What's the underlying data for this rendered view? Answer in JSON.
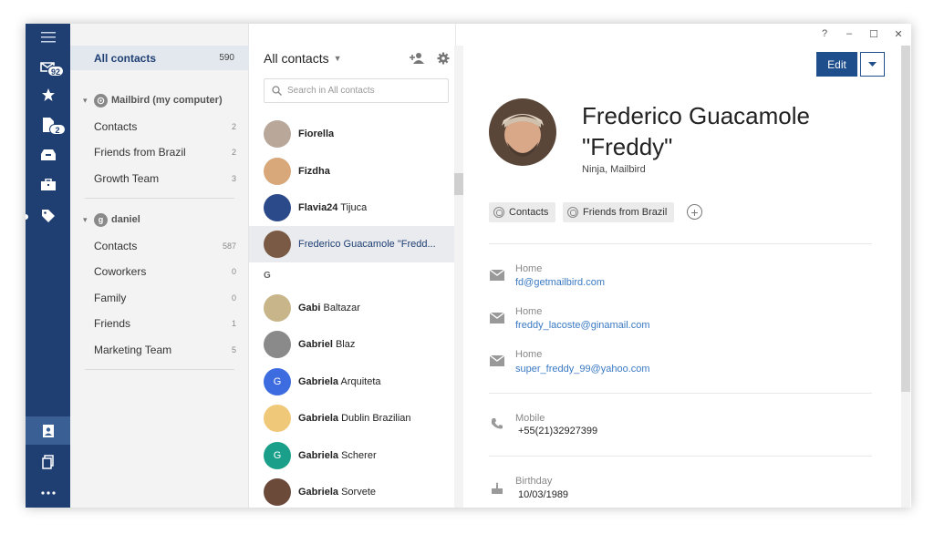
{
  "rail": {
    "mail_badge": "92",
    "notes_badge": "2"
  },
  "groups": {
    "all_label": "All contacts",
    "all_count": "590",
    "accounts": [
      {
        "name": "Mailbird (my computer)",
        "items": [
          {
            "label": "Contacts",
            "count": "2"
          },
          {
            "label": "Friends from Brazil",
            "count": "2"
          },
          {
            "label": "Growth Team",
            "count": "3"
          }
        ]
      },
      {
        "initial": "g",
        "name": "daniel",
        "items": [
          {
            "label": "Contacts",
            "count": "587"
          },
          {
            "label": "Coworkers",
            "count": "0"
          },
          {
            "label": "Family",
            "count": "0"
          },
          {
            "label": "Friends",
            "count": "1"
          },
          {
            "label": "Marketing Team",
            "count": "5"
          }
        ]
      }
    ]
  },
  "contacts": {
    "title": "All contacts",
    "search_placeholder": "Search in All contacts",
    "section_letter": "G",
    "rows": [
      {
        "first": "Fiorella",
        "rest": "",
        "avatar_color": "#b9a89a",
        "initial": ""
      },
      {
        "first": "Fizdha",
        "rest": "",
        "avatar_color": "#d8a77a",
        "initial": ""
      },
      {
        "first": "Flavia24",
        "rest": "Tijuca",
        "avatar_color": "#2a4a8a",
        "initial": ""
      },
      {
        "first": "Frederico Guacamole \"Fredd...",
        "rest": "",
        "avatar_color": "#7a5a44",
        "initial": ""
      },
      {
        "first": "Gabi",
        "rest": "Baltazar",
        "avatar_color": "#c9b58a",
        "initial": ""
      },
      {
        "first": "Gabriel",
        "rest": "Blaz",
        "avatar_color": "#8a8a8a",
        "initial": ""
      },
      {
        "first": "Gabriela",
        "rest": "Arquiteta",
        "avatar_color": "#3d6be0",
        "initial": "G"
      },
      {
        "first": "Gabriela",
        "rest": "Dublin Brazilian",
        "avatar_color": "#f0c87a",
        "initial": ""
      },
      {
        "first": "Gabriela",
        "rest": "Scherer",
        "avatar_color": "#1aa08a",
        "initial": "G"
      },
      {
        "first": "Gabriela",
        "rest": "Sorvete",
        "avatar_color": "#6b4a3a",
        "initial": ""
      }
    ]
  },
  "detail": {
    "window_controls": [
      "?",
      "–",
      "☐",
      "✕"
    ],
    "edit_label": "Edit",
    "name": "Frederico Guacamole \"Freddy\"",
    "subtitle": "Ninja, Mailbird",
    "tags": [
      "Contacts",
      "Friends from Brazil"
    ],
    "emails": [
      {
        "label": "Home",
        "value": "fd@getmailbird.com"
      },
      {
        "label": "Home",
        "value": "freddy_lacoste@ginamail.com"
      },
      {
        "label": "Home",
        "value": "super_freddy_99@yahoo.com"
      }
    ],
    "phone": {
      "label": "Mobile",
      "value": "+55(21)32927399"
    },
    "birthday": {
      "label": "Birthday",
      "value": "10/03/1989"
    }
  },
  "colors": {
    "rail": "#1f3f73",
    "accent": "#1f4e8c",
    "link": "#3a7ac4"
  }
}
